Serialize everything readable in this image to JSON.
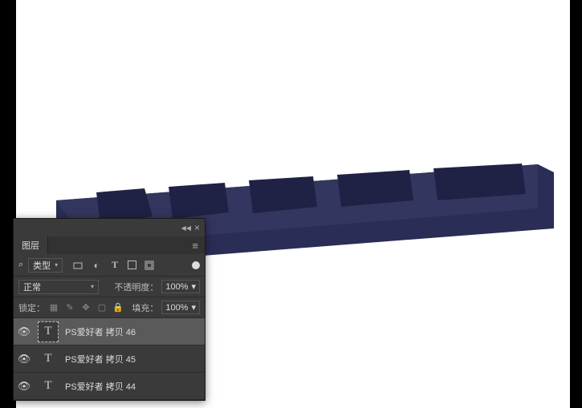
{
  "panel": {
    "tab_label": "图层",
    "filter_label": "类型",
    "blend_mode": "正常",
    "opacity_label": "不透明度：",
    "opacity_value": "100%",
    "lock_label": "锁定：",
    "fill_label": "填充：",
    "fill_value": "100%"
  },
  "layers": [
    {
      "name": "PS爱好者 拷贝 46",
      "selected": true
    },
    {
      "name": "PS爱好者 拷贝 45",
      "selected": false
    },
    {
      "name": "PS爱好者 拷贝 44",
      "selected": false
    }
  ]
}
